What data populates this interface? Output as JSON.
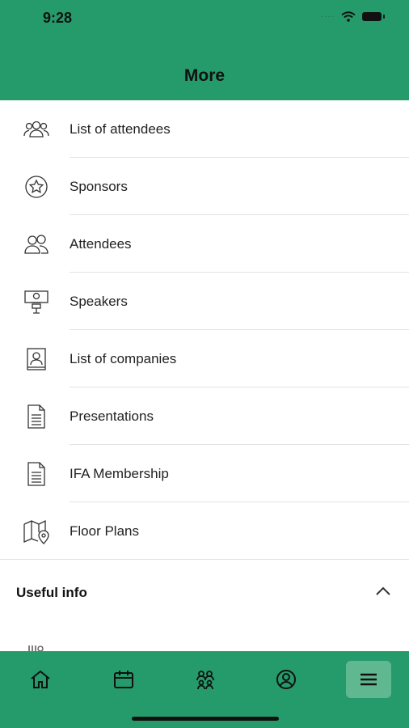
{
  "status_bar": {
    "time": "9:28"
  },
  "header": {
    "title": "More"
  },
  "menu": [
    {
      "label": "List of attendees",
      "icon": "people-group-icon"
    },
    {
      "label": "Sponsors",
      "icon": "star-badge-icon"
    },
    {
      "label": "Attendees",
      "icon": "users-icon"
    },
    {
      "label": "Speakers",
      "icon": "speaker-podium-icon"
    },
    {
      "label": "List of companies",
      "icon": "company-card-icon"
    },
    {
      "label": "Presentations",
      "icon": "document-icon"
    },
    {
      "label": "IFA Membership",
      "icon": "document-icon"
    },
    {
      "label": "Floor Plans",
      "icon": "map-pin-icon"
    }
  ],
  "useful_info": {
    "title": "Useful info",
    "expanded": true
  },
  "tabbar": {
    "tabs": [
      {
        "icon": "home-icon"
      },
      {
        "icon": "calendar-icon"
      },
      {
        "icon": "attendees-icon"
      },
      {
        "icon": "profile-icon"
      },
      {
        "icon": "menu-icon",
        "active": true
      }
    ]
  },
  "colors": {
    "brand_green": "#259b6b",
    "active_tab": "#5fb890"
  }
}
